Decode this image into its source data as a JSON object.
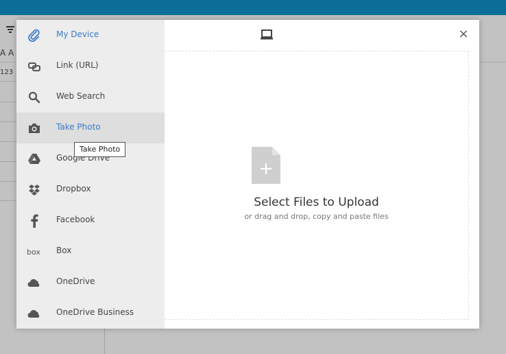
{
  "background": {
    "col_header_label": "A A",
    "cell_value": "123"
  },
  "picker": {
    "sources": [
      {
        "label": "My Device",
        "icon": "paperclip-icon"
      },
      {
        "label": "Link (URL)",
        "icon": "link-icon"
      },
      {
        "label": "Web Search",
        "icon": "search-icon"
      },
      {
        "label": "Take Photo",
        "icon": "camera-icon"
      },
      {
        "label": "Google Drive",
        "icon": "google-drive-icon"
      },
      {
        "label": "Dropbox",
        "icon": "dropbox-icon"
      },
      {
        "label": "Facebook",
        "icon": "facebook-icon"
      },
      {
        "label": "Box",
        "icon": "box-icon"
      },
      {
        "label": "OneDrive",
        "icon": "onedrive-icon"
      },
      {
        "label": "OneDrive Business",
        "icon": "onedrive-business-icon"
      }
    ],
    "active_source": "My Device",
    "hovered_source": "Take Photo",
    "tooltip": "Take Photo",
    "close_symbol": "×",
    "upload_title": "Select Files to Upload",
    "upload_subtitle": "or drag and drop, copy and paste files",
    "colors": {
      "accent": "#3a7ac8",
      "topbar": "#0c6f97",
      "sidebar_bg": "#ededed",
      "hover_bg": "#dedede"
    }
  }
}
